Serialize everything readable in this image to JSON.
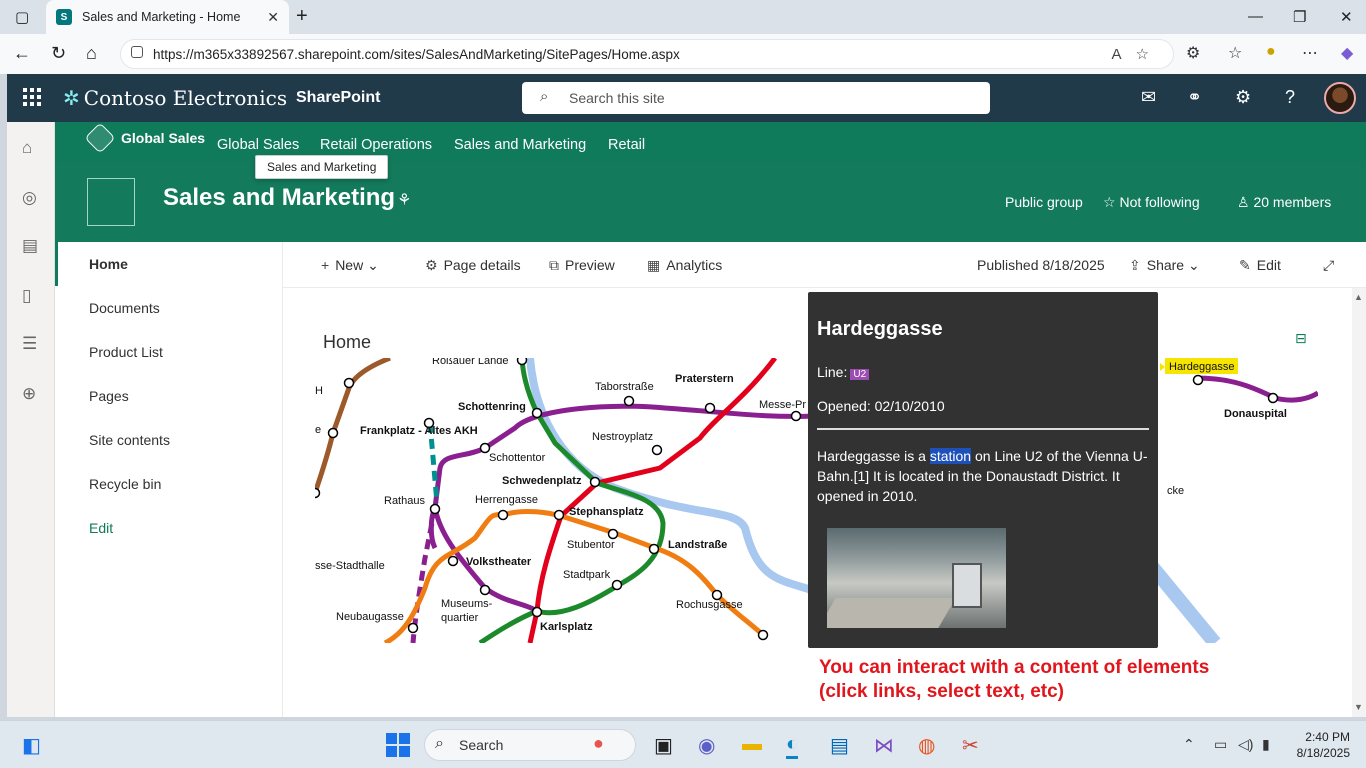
{
  "browser": {
    "tab_title": "Sales and Marketing - Home",
    "url": "https://m365x33892567.sharepoint.com/sites/SalesAndMarketing/SitePages/Home.aspx"
  },
  "suitebar": {
    "brand": "Contoso Electronics",
    "app": "SharePoint",
    "search_placeholder": "Search this site"
  },
  "hub": {
    "home": "Global Sales",
    "links": [
      "Global Sales",
      "Retail Operations",
      "Sales and Marketing",
      "Retail"
    ],
    "tooltip": "Sales and Marketing"
  },
  "site": {
    "title": "Sales and Marketing",
    "privacy": "Public group",
    "follow": "Not following",
    "members": "20 members"
  },
  "leftnav": {
    "items": [
      "Home",
      "Documents",
      "Product List",
      "Pages",
      "Site contents",
      "Recycle bin"
    ],
    "edit": "Edit"
  },
  "commandbar": {
    "new": "New",
    "page_details": "Page details",
    "preview": "Preview",
    "analytics": "Analytics",
    "published": "Published 8/18/2025",
    "share": "Share",
    "edit": "Edit"
  },
  "page": {
    "title": "Home"
  },
  "map": {
    "labels": [
      "Roßauer Lände",
      "Taborstraße",
      "Praterstern",
      "Messe-Pr",
      "Schottenring",
      "Frankplatz - Altes AKH",
      "Nestroyplatz",
      "Schottentor",
      "Schwedenplatz",
      "Rathaus",
      "Herrengasse",
      "Stephansplatz",
      "Stubentor",
      "Landstraße",
      "Volkstheater",
      "sse-Stadthalle",
      "Stadtpark",
      "Museums-",
      "quartier",
      "Neubaugasse",
      "Karlsplatz",
      "Rochusgasse",
      "Hardeggasse",
      "Donauspital",
      "cke",
      "H",
      "e"
    ]
  },
  "popup": {
    "title": "Hardeggasse",
    "line_label": "Line:",
    "line_badge": "U2",
    "opened": "Opened: 02/10/2010",
    "desc_before": "Hardeggasse is a ",
    "desc_highlight": "station",
    "desc_after": " on Line U2 of the Vienna U-Bahn.[1] It is located in the Donaustadt District. It opened in 2010."
  },
  "note": {
    "line1": "You can interact with a content of elements",
    "line2": "(click links, select text, etc)"
  },
  "taskbar": {
    "search": "Search",
    "time": "2:40 PM",
    "date": "8/18/2025"
  },
  "colors": {
    "suitebar": "#203a4a",
    "hub": "#0f7b5a",
    "u1": "#e2001a",
    "u2": "#8a1f8f",
    "u3": "#f07d11",
    "u4": "#1c8a2a",
    "u6": "#9c5a2a",
    "river": "#a8c8f0",
    "note": "#e1161c"
  }
}
